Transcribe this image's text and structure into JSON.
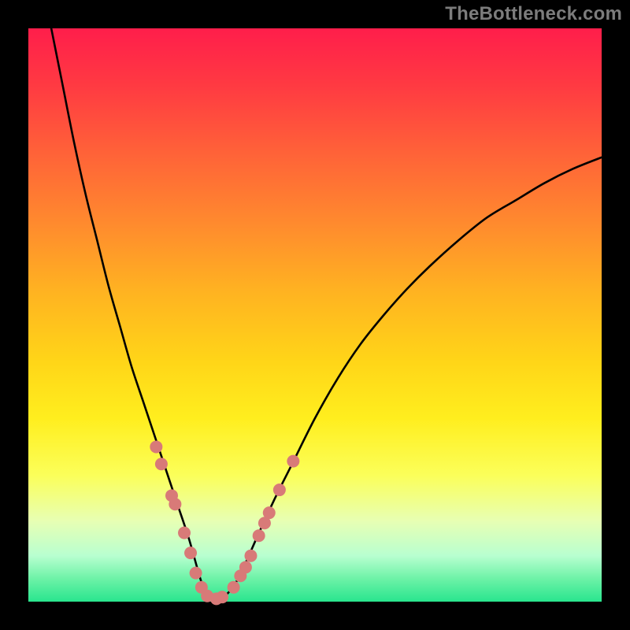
{
  "watermark": "TheBottleneck.com",
  "chart_data": {
    "type": "line",
    "title": "",
    "xlabel": "",
    "ylabel": "",
    "x_range": [
      0,
      100
    ],
    "y_range_percent_from_top": [
      0,
      100
    ],
    "series": [
      {
        "name": "bottleneck-curve",
        "color": "#000000",
        "x": [
          4,
          6,
          8,
          10,
          12,
          14,
          16,
          18,
          20,
          22,
          24,
          26,
          28,
          30,
          31,
          32,
          33,
          34,
          36,
          38,
          40,
          43,
          46,
          50,
          54,
          58,
          62,
          66,
          70,
          75,
          80,
          85,
          90,
          95,
          100
        ],
        "y_pct_from_top": [
          0,
          10,
          20,
          29,
          37,
          45,
          52,
          59,
          65,
          71,
          77,
          83,
          89,
          96,
          98.5,
          99.3,
          99.7,
          99.3,
          97,
          93,
          88.5,
          82,
          76,
          68,
          61,
          55,
          50,
          45.5,
          41.5,
          37,
          33,
          30,
          27,
          24.5,
          22.5
        ]
      }
    ],
    "markers": {
      "name": "highlight-dots",
      "color": "#d87a78",
      "radius": 8,
      "points_x": [
        22.3,
        23.2,
        25.0,
        25.6,
        27.2,
        28.3,
        29.2,
        30.2,
        31.2,
        32.8,
        33.8,
        35.8,
        37.0,
        37.9,
        38.8,
        40.2,
        41.2,
        42.0,
        43.8,
        46.2
      ],
      "points_y_pct_from_top": [
        73.0,
        76.0,
        81.5,
        83.0,
        88.0,
        91.5,
        95.0,
        97.5,
        99.0,
        99.5,
        99.2,
        97.5,
        95.5,
        94.0,
        92.0,
        88.5,
        86.3,
        84.5,
        80.5,
        75.5
      ]
    }
  }
}
